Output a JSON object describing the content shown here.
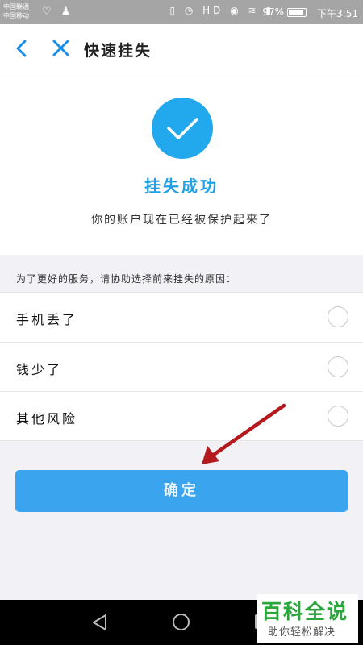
{
  "status_bar": {
    "carrier_1": "中国联通",
    "carrier_2": "中国移动",
    "battery": "97%",
    "time": "下午3:51",
    "left_icons": "♡ ♟",
    "right_icons": "▯ ◷ HD ◉ ≋ ▮"
  },
  "nav": {
    "back_icon": "‹",
    "close_icon": "×",
    "title": "快速挂失"
  },
  "success": {
    "title": "挂失成功",
    "description": "你的账户现在已经被保护起来了",
    "accent_color": "#22a8ec"
  },
  "reasons": {
    "prompt": "为了更好的服务，请协助选择前来挂失的原因：",
    "items": [
      {
        "label": "手机丢了"
      },
      {
        "label": "钱少了"
      },
      {
        "label": "其他风险"
      }
    ]
  },
  "confirm": {
    "label": "确定",
    "color": "#3ba4ee"
  },
  "annotation": {
    "arrow_color": "#b3191d"
  },
  "watermark": {
    "title": "百科全说",
    "subtitle": "助你轻松解决"
  }
}
